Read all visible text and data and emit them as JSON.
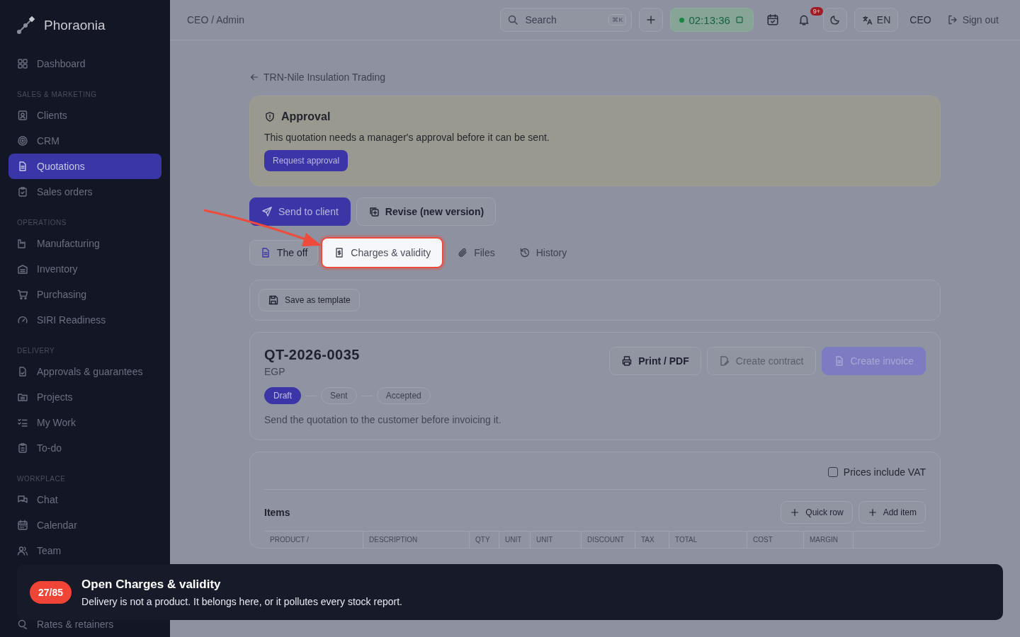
{
  "sidebar": {
    "brand": "Phoraonia",
    "sections": [
      {
        "items": [
          {
            "label": "Dashboard",
            "selected": false
          }
        ]
      },
      {
        "heading": "SALES & MARKETING",
        "items": [
          {
            "label": "Clients",
            "selected": false
          },
          {
            "label": "CRM",
            "selected": false
          },
          {
            "label": "Quotations",
            "selected": true
          },
          {
            "label": "Sales orders",
            "selected": false
          }
        ]
      },
      {
        "heading": "OPERATIONS",
        "items": [
          {
            "label": "Manufacturing",
            "selected": false
          },
          {
            "label": "Inventory",
            "selected": false
          },
          {
            "label": "Purchasing",
            "selected": false
          },
          {
            "label": "SIRI Readiness",
            "selected": false
          }
        ]
      },
      {
        "heading": "DELIVERY",
        "items": [
          {
            "label": "Approvals & guarantees",
            "selected": false
          },
          {
            "label": "Projects",
            "selected": false
          },
          {
            "label": "My Work",
            "selected": false
          },
          {
            "label": "To-do",
            "selected": false
          }
        ]
      },
      {
        "heading": "WORKPLACE",
        "items": [
          {
            "label": "Chat",
            "selected": false
          },
          {
            "label": "Calendar",
            "selected": false
          },
          {
            "label": "Team",
            "selected": false
          },
          {
            "label": "Rates & retainers",
            "selected": false
          }
        ]
      }
    ]
  },
  "topbar": {
    "breadcrumb": "CEO / Admin",
    "search": {
      "placeholder": "Search",
      "shortcut": "⌘K"
    },
    "timer": "02:13:36",
    "notifications": "9+",
    "language": "EN",
    "user": "CEO",
    "sign_out": "Sign out"
  },
  "back_link": "TRN-Nile Insulation Trading",
  "approval": {
    "title": "Approval",
    "message": "This quotation needs a manager's approval before it can be sent.",
    "button": "Request approval"
  },
  "actions": [
    {
      "label": "Send to client",
      "kind": "primary"
    },
    {
      "label": "Revise (new version)",
      "kind": "secondary"
    }
  ],
  "tabs": [
    {
      "label": "The off",
      "selected": true,
      "spotlight": false
    },
    {
      "label": "Charges & validity",
      "selected": false,
      "spotlight": true
    },
    {
      "label": "Files",
      "selected": false,
      "spotlight": false
    },
    {
      "label": "History",
      "selected": false,
      "spotlight": false
    }
  ],
  "template_button": "Save as template",
  "quote": {
    "number": "QT-2026-0035",
    "currency": "EGP",
    "buttons": [
      {
        "label": "Print / PDF",
        "kind": "secondary",
        "disabled": false
      },
      {
        "label": "Create contract",
        "kind": "secondary",
        "disabled": true
      },
      {
        "label": "Create invoice",
        "kind": "primary",
        "disabled": true
      }
    ],
    "stages": [
      {
        "label": "Draft",
        "selected": true
      },
      {
        "label": "Sent",
        "selected": false
      },
      {
        "label": "Accepted",
        "selected": false
      }
    ],
    "hint": "Send the quotation to the customer before invoicing it."
  },
  "items": {
    "vat": {
      "label": "Prices include VAT",
      "checked": false
    },
    "title": "Items",
    "buttons": [
      "Quick row",
      "Add item"
    ],
    "columns": [
      "PRODUCT /",
      "DESCRIPTION",
      "QTY",
      "UNIT",
      "UNIT",
      "DISCOUNT",
      "TAX",
      "TOTAL",
      "COST",
      "MARGIN"
    ]
  },
  "tour": {
    "step": "27/85",
    "title": "Open Charges & validity",
    "body": "Delivery is not a product. It belongs here, or it pollutes every stock report."
  }
}
